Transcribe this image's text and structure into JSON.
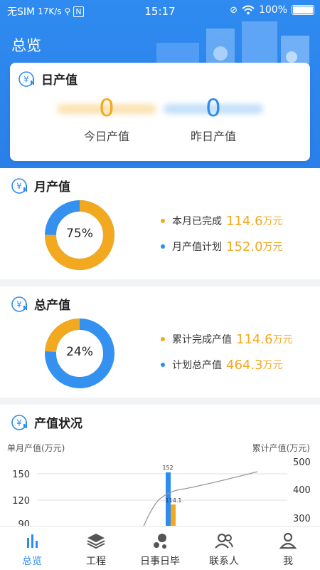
{
  "status_bar": {
    "carrier": "无SIM",
    "speed": "17K/s",
    "time": "15:17",
    "battery": "100%"
  },
  "header": {
    "title": "总览"
  },
  "daily": {
    "title": "日产值",
    "today_value": "0",
    "today_label": "今日产值",
    "yesterday_value": "0",
    "yesterday_label": "昨日产值"
  },
  "monthly": {
    "title": "月产值",
    "percent_label": "75%",
    "percent": 75,
    "completed_label": "本月已完成",
    "completed_value": "114.6",
    "completed_unit": "万元",
    "plan_label": "月产值计划",
    "plan_value": "152.0",
    "plan_unit": "万元"
  },
  "total": {
    "title": "总产值",
    "percent_label": "24%",
    "percent": 24,
    "completed_label": "累计完成产值",
    "completed_value": "114.6",
    "completed_unit": "万元",
    "plan_label": "计划总产值",
    "plan_value": "464.3",
    "plan_unit": "万元"
  },
  "status": {
    "title": "产值状况",
    "left_axis_title": "单月产值(万元)",
    "right_axis_title": "累计产值(万元)"
  },
  "chart_data": {
    "type": "bar",
    "left_axis": {
      "ticks": [
        150,
        120,
        90
      ]
    },
    "right_axis": {
      "ticks": [
        500,
        400,
        300
      ]
    },
    "series": [
      {
        "values": [
          152
        ],
        "axis": "left",
        "color": "#2d8cf0"
      },
      {
        "values": [
          114.1
        ],
        "axis": "left",
        "color": "#f3a91f"
      },
      {
        "type": "line",
        "axis": "right",
        "color": "#999999"
      }
    ],
    "data_labels": [
      "152",
      "114.1"
    ]
  },
  "tabs": [
    {
      "label": "总览",
      "icon": "bar-chart-icon",
      "active": true
    },
    {
      "label": "工程",
      "icon": "layers-icon",
      "active": false
    },
    {
      "label": "日事日毕",
      "icon": "dots-icon",
      "active": false
    },
    {
      "label": "联系人",
      "icon": "contacts-icon",
      "active": false
    },
    {
      "label": "我",
      "icon": "person-icon",
      "active": false
    }
  ],
  "colors": {
    "primary": "#2d8cf0",
    "accent": "#f3a91f",
    "header_bg": "#2f8bf0"
  }
}
